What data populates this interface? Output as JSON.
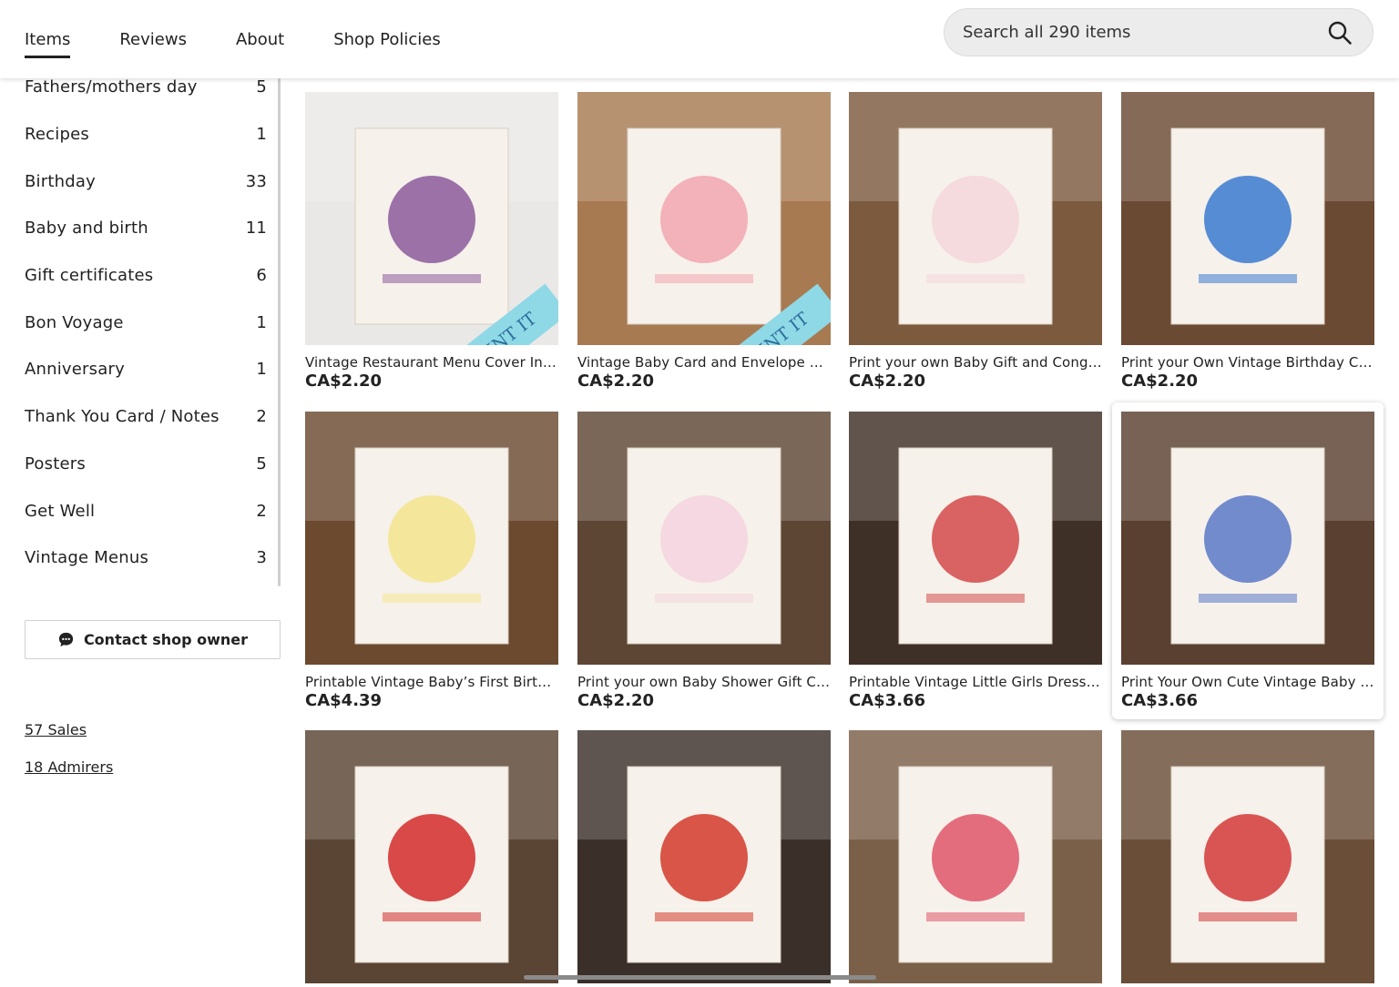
{
  "nav": {
    "tabs": [
      {
        "label": "Items",
        "active": true
      },
      {
        "label": "Reviews",
        "active": false
      },
      {
        "label": "About",
        "active": false
      },
      {
        "label": "Shop Policies",
        "active": false
      }
    ],
    "search_placeholder": "Search all 290 items"
  },
  "sidebar": {
    "categories": [
      {
        "label": "Fathers/mothers day",
        "count": "5"
      },
      {
        "label": "Recipes",
        "count": "1"
      },
      {
        "label": "Birthday",
        "count": "33"
      },
      {
        "label": "Baby and birth",
        "count": "11"
      },
      {
        "label": "Gift certificates",
        "count": "6"
      },
      {
        "label": "Bon Voyage",
        "count": "1"
      },
      {
        "label": "Anniversary",
        "count": "1"
      },
      {
        "label": "Thank You Card / Notes",
        "count": "2"
      },
      {
        "label": "Posters",
        "count": "5"
      },
      {
        "label": "Get Well",
        "count": "2"
      },
      {
        "label": "Vintage Menus",
        "count": "3"
      }
    ],
    "contact_label": "Contact shop owner",
    "sales_label": "57 Sales",
    "admirers_label": "18 Admirers"
  },
  "listings": [
    {
      "title": "Vintage Restaurant Menu Cover Insta...",
      "price": "CA$2.20",
      "bg": "#e9e8e6",
      "accent": "#8b5a9c",
      "banner": "RETRO PRINT IT"
    },
    {
      "title": "Vintage Baby Card and Envelope Digi...",
      "price": "CA$2.20",
      "bg": "#a87a52",
      "accent": "#f2a6b0",
      "banner": "RETRO PRINT IT"
    },
    {
      "title": "Print your own Baby Gift and Congrat...",
      "price": "CA$2.20",
      "bg": "#7c5a3e",
      "accent": "#f5d6dc",
      "banner": ""
    },
    {
      "title": "Print your Own Vintage Birthday Car...",
      "price": "CA$2.20",
      "bg": "#6b4a33",
      "accent": "#3a7ad0",
      "banner": ""
    },
    {
      "title": "Printable Vintage Baby’s First Birthda...",
      "price": "CA$4.39",
      "bg": "#6b4a30",
      "accent": "#f3e58e",
      "banner": ""
    },
    {
      "title": "Print your own Baby Shower Gift Car...",
      "price": "CA$2.20",
      "bg": "#5e4634",
      "accent": "#f4d3df",
      "banner": ""
    },
    {
      "title": "Printable Vintage Little Girls Dressed ...",
      "price": "CA$3.66",
      "bg": "#3e2f27",
      "accent": "#d44a4a",
      "banner": ""
    },
    {
      "title": "Print Your Own Cute Vintage Baby Re...",
      "price": "CA$3.66",
      "bg": "#5a4030",
      "accent": "#5a79c8",
      "banner": ""
    },
    {
      "title": "",
      "price": "",
      "bg": "#5a4434",
      "accent": "#d22b2b",
      "banner": ""
    },
    {
      "title": "",
      "price": "",
      "bg": "#3b2f2a",
      "accent": "#d33a2a",
      "banner": ""
    },
    {
      "title": "",
      "price": "",
      "bg": "#7a6048",
      "accent": "#e0566a",
      "banner": ""
    },
    {
      "title": "",
      "price": "",
      "bg": "#6a4e38",
      "accent": "#d33a3a",
      "banner": ""
    }
  ]
}
